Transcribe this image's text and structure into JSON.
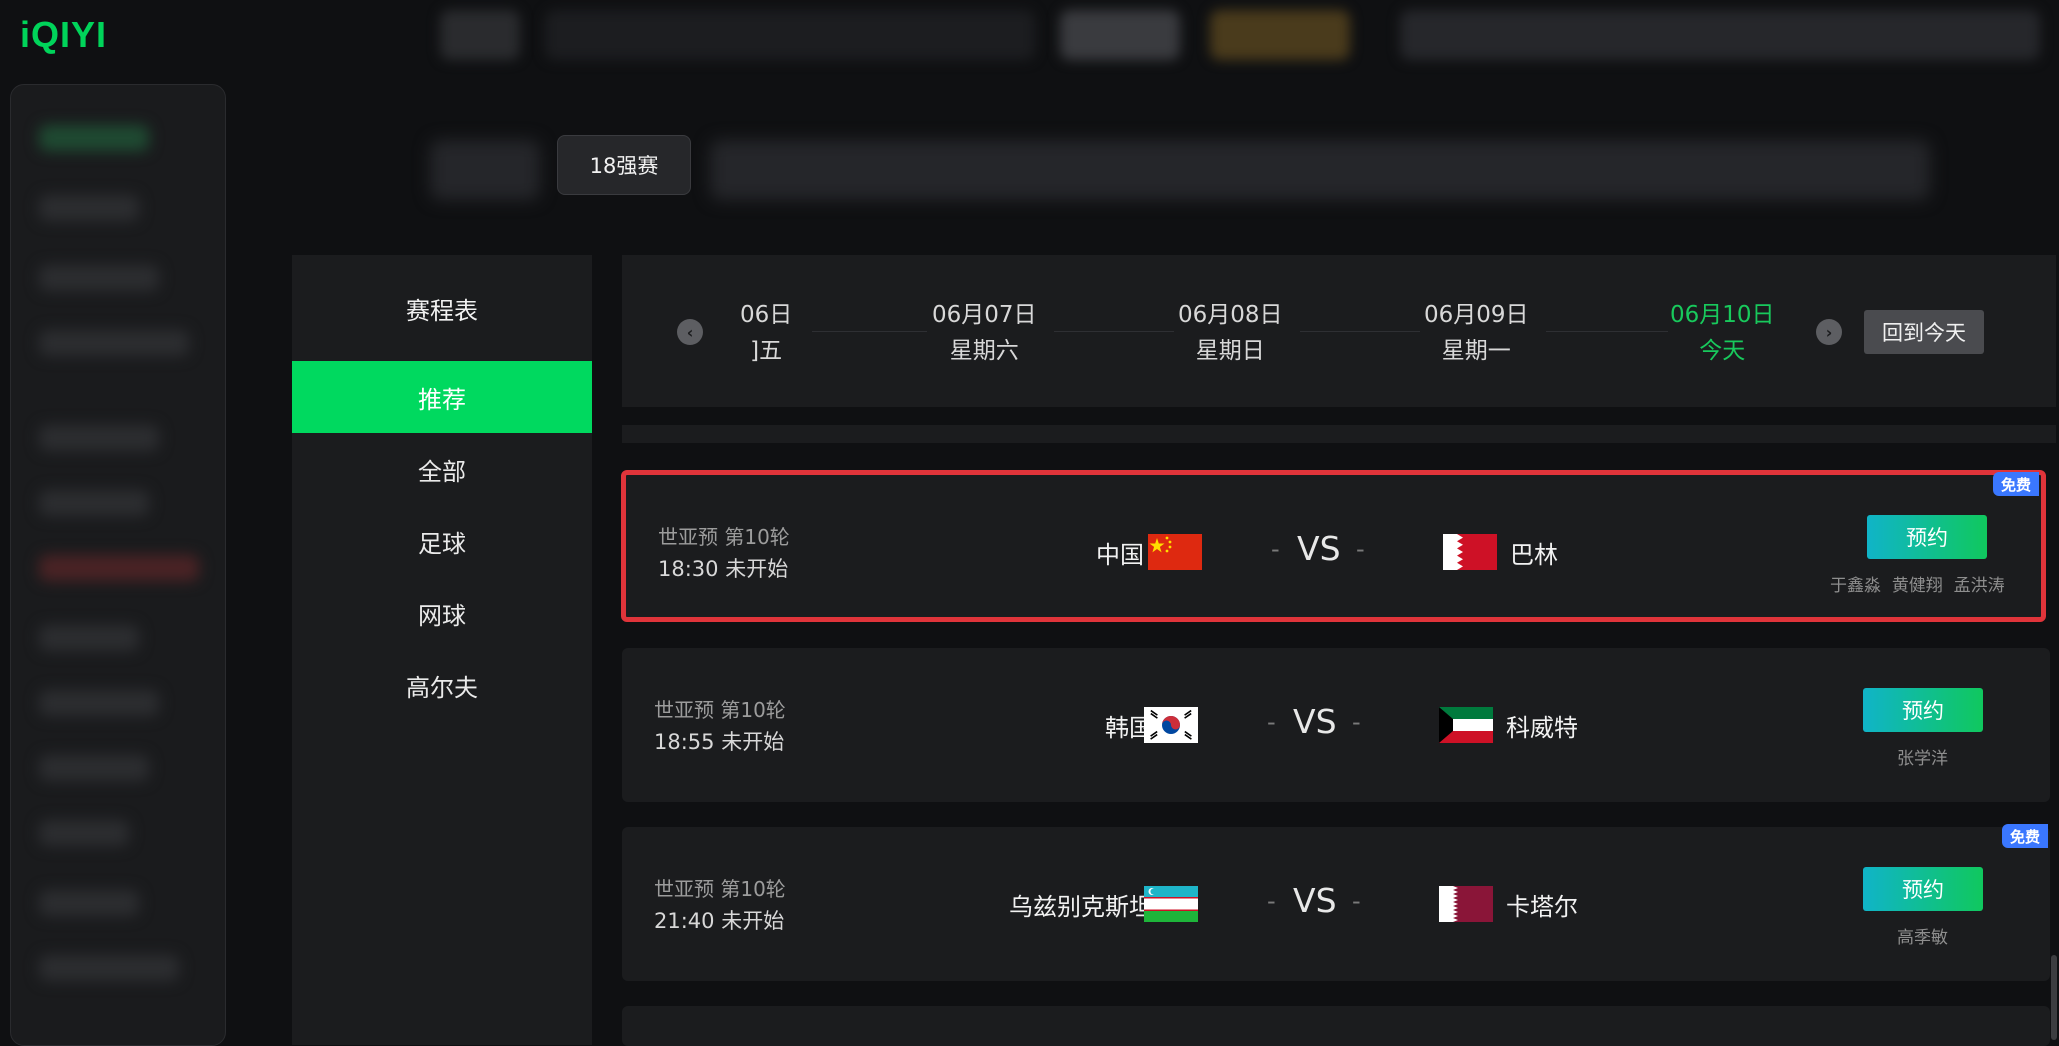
{
  "app": {
    "logo": "iQIYI"
  },
  "tabs": {
    "selected": "18强赛"
  },
  "sidebar": {
    "title": "赛程表",
    "items": [
      {
        "label": "推荐",
        "active": true
      },
      {
        "label": "全部"
      },
      {
        "label": "足球"
      },
      {
        "label": "网球"
      },
      {
        "label": "高尔夫"
      }
    ]
  },
  "date_bar": {
    "prev_icon": "chevron-left-icon",
    "next_icon": "chevron-right-icon",
    "dates": [
      {
        "date": "06日",
        "weekday": "]五"
      },
      {
        "date": "06月07日",
        "weekday": "星期六"
      },
      {
        "date": "06月08日",
        "weekday": "星期日"
      },
      {
        "date": "06月09日",
        "weekday": "星期一"
      },
      {
        "date": "06月10日",
        "weekday": "今天",
        "today": true
      }
    ],
    "back_today": "回到今天"
  },
  "matches": [
    {
      "round": "世亚预 第10轮",
      "time": "18:30 未开始",
      "home": "中国",
      "away": "巴林",
      "vs": "VS",
      "dash": "-",
      "button": "预约",
      "commentators": [
        "于鑫淼",
        "黄健翔",
        "孟洪涛"
      ],
      "free": "免费",
      "highlight": true
    },
    {
      "round": "世亚预 第10轮",
      "time": "18:55 未开始",
      "home": "韩国",
      "away": "科威特",
      "vs": "VS",
      "dash": "-",
      "button": "预约",
      "commentators": [
        "张学洋"
      ]
    },
    {
      "round": "世亚预 第10轮",
      "time": "21:40 未开始",
      "home": "乌兹别克斯坦",
      "away": "卡塔尔",
      "vs": "VS",
      "dash": "-",
      "button": "预约",
      "commentators": [
        "高季敏"
      ],
      "free": "免费"
    }
  ],
  "colors": {
    "accent": "#00d95f",
    "today": "#18c95c",
    "highlight_border": "#e0343a",
    "free_badge": "#3a77ff"
  }
}
